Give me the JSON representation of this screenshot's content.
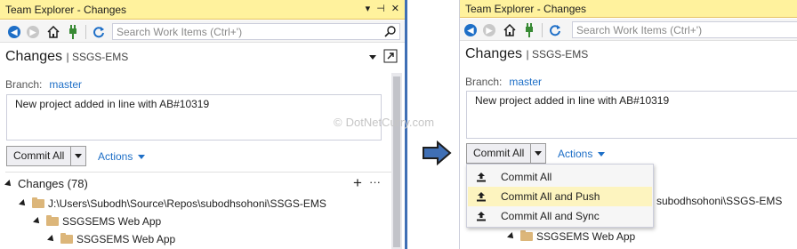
{
  "left": {
    "title": "Team Explorer - Changes",
    "search_placeholder": "Search Work Items (Ctrl+')",
    "page_title": "Changes",
    "page_subtitle": "SSGS-EMS",
    "branch_label": "Branch:",
    "branch_value": "master",
    "commit_message": "New project added in line with AB#10319",
    "commit_button": "Commit All",
    "actions_label": "Actions",
    "changes_header": "Changes (78)",
    "tree": [
      "J:\\Users\\Subodh\\Source\\Repos\\subodhsohoni\\SSGS-EMS",
      "SSGSEMS Web App",
      "SSGSEMS Web App"
    ]
  },
  "right": {
    "title": "Team Explorer - Changes",
    "search_placeholder": "Search Work Items (Ctrl+')",
    "page_title": "Changes",
    "page_subtitle": "SSGS-EMS",
    "branch_label": "Branch:",
    "branch_value": "master",
    "commit_message": "New project added in line with AB#10319",
    "commit_button": "Commit All",
    "actions_label": "Actions",
    "tree_partial": "subodhsohoni\\SSGS-EMS",
    "tree_partial_2": "SSGSEMS Web App",
    "menu": [
      "Commit All",
      "Commit All and Push",
      "Commit All and Sync"
    ]
  },
  "watermark": "DotNetCurry.com",
  "colors": {
    "titlebar": "#fff29d",
    "accent_blue": "#1e6fc7",
    "menu_highlight": "#fdf4bf",
    "arrow_fill": "#3f6fb5"
  }
}
